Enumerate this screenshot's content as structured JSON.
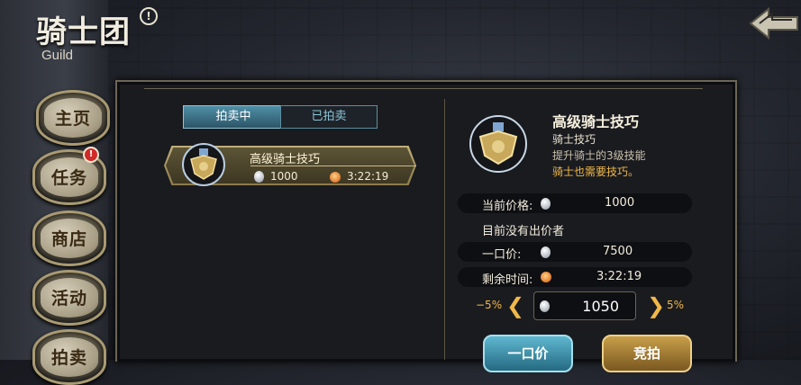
{
  "header": {
    "title": "骑士团",
    "subtitle": "Guild",
    "info_icon": "!"
  },
  "side_nav": [
    {
      "label": "主页"
    },
    {
      "label": "任务",
      "badge": "!"
    },
    {
      "label": "商店"
    },
    {
      "label": "活动"
    },
    {
      "label": "拍卖"
    }
  ],
  "tabs": {
    "active": "拍卖中",
    "inactive": "已拍卖"
  },
  "listing": {
    "name": "高级骑士技巧",
    "price": "1000",
    "time_left": "3:22:19"
  },
  "detail": {
    "title": "高级骑士技巧",
    "subtitle": "骑士技巧",
    "desc1": "提升骑士的3级技能",
    "desc2": "骑士也需要技巧。",
    "current_price_label": "当前价格:",
    "current_price": "1000",
    "no_bid_text": "目前没有出价者",
    "buyout_label": "一口价:",
    "buyout_price": "7500",
    "remaining_label": "剩余时间:",
    "remaining_time": "3:22:19"
  },
  "bid_stepper": {
    "minus_label": "−5%",
    "value": "1050",
    "plus_label": "5%"
  },
  "actions": {
    "buyout_button": "一口价",
    "bid_button": "竞拍"
  },
  "colors": {
    "accent_gold": "#f0b84a",
    "tab_blue": "#4f8fa6",
    "panel_bg": "#1a1b1f"
  }
}
